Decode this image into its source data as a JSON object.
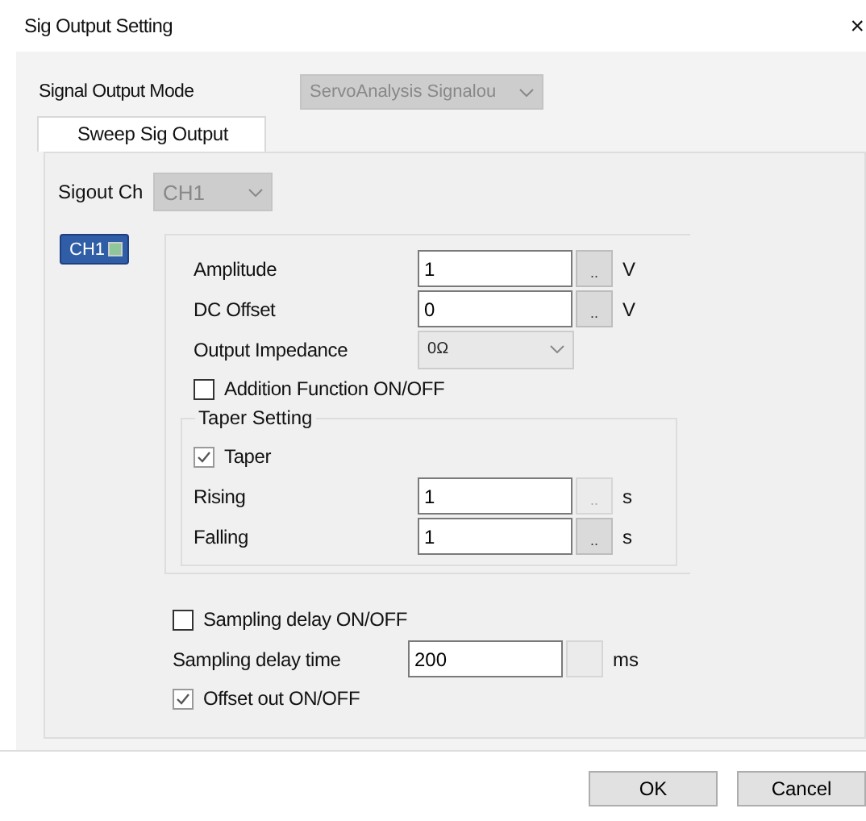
{
  "window": {
    "title": "Sig Output Setting",
    "close": "×"
  },
  "mode": {
    "label": "Signal Output Mode",
    "value": "ServoAnalysis Signalou",
    "disabled": true
  },
  "tabs": [
    {
      "label": "Sweep  Sig Output",
      "selected": true
    }
  ],
  "channel": {
    "label": "Sigout Ch",
    "value": "CH1",
    "disabled": true
  },
  "channel_tag": {
    "label": "CH1",
    "on": true
  },
  "settings": [
    {
      "kind": "field",
      "label": "Amplitude",
      "value": "1",
      "button": "..",
      "button_disabled": false,
      "unit": "V"
    },
    {
      "kind": "field",
      "label": "DC Offset",
      "value": "0",
      "button": "..",
      "button_disabled": false,
      "unit": "V"
    },
    {
      "kind": "select",
      "label": "Output Impedance",
      "value": "0Ω"
    },
    {
      "kind": "checkbox",
      "label": "Addition Function ON/OFF",
      "checked": false,
      "disabled": false
    }
  ],
  "taper": {
    "title": "Taper Setting",
    "rows": [
      {
        "kind": "checkbox",
        "label": "Taper",
        "checked": true,
        "disabled": true
      },
      {
        "kind": "field",
        "label": "Rising",
        "value": "1",
        "button": "..",
        "button_disabled": true,
        "unit": "s"
      },
      {
        "kind": "field",
        "label": "Falling",
        "value": "1",
        "button": "..",
        "button_disabled": false,
        "unit": "s"
      }
    ]
  },
  "sampling": [
    {
      "kind": "checkbox",
      "label": "Sampling delay ON/OFF",
      "checked": false,
      "disabled": false
    },
    {
      "kind": "field",
      "label": "Sampling delay time",
      "value": "200",
      "button_disabled": true,
      "unit": "ms"
    },
    {
      "kind": "checkbox",
      "label": "Offset out ON/OFF",
      "checked": true,
      "disabled": true
    }
  ],
  "buttons": [
    "OK",
    "Cancel"
  ]
}
